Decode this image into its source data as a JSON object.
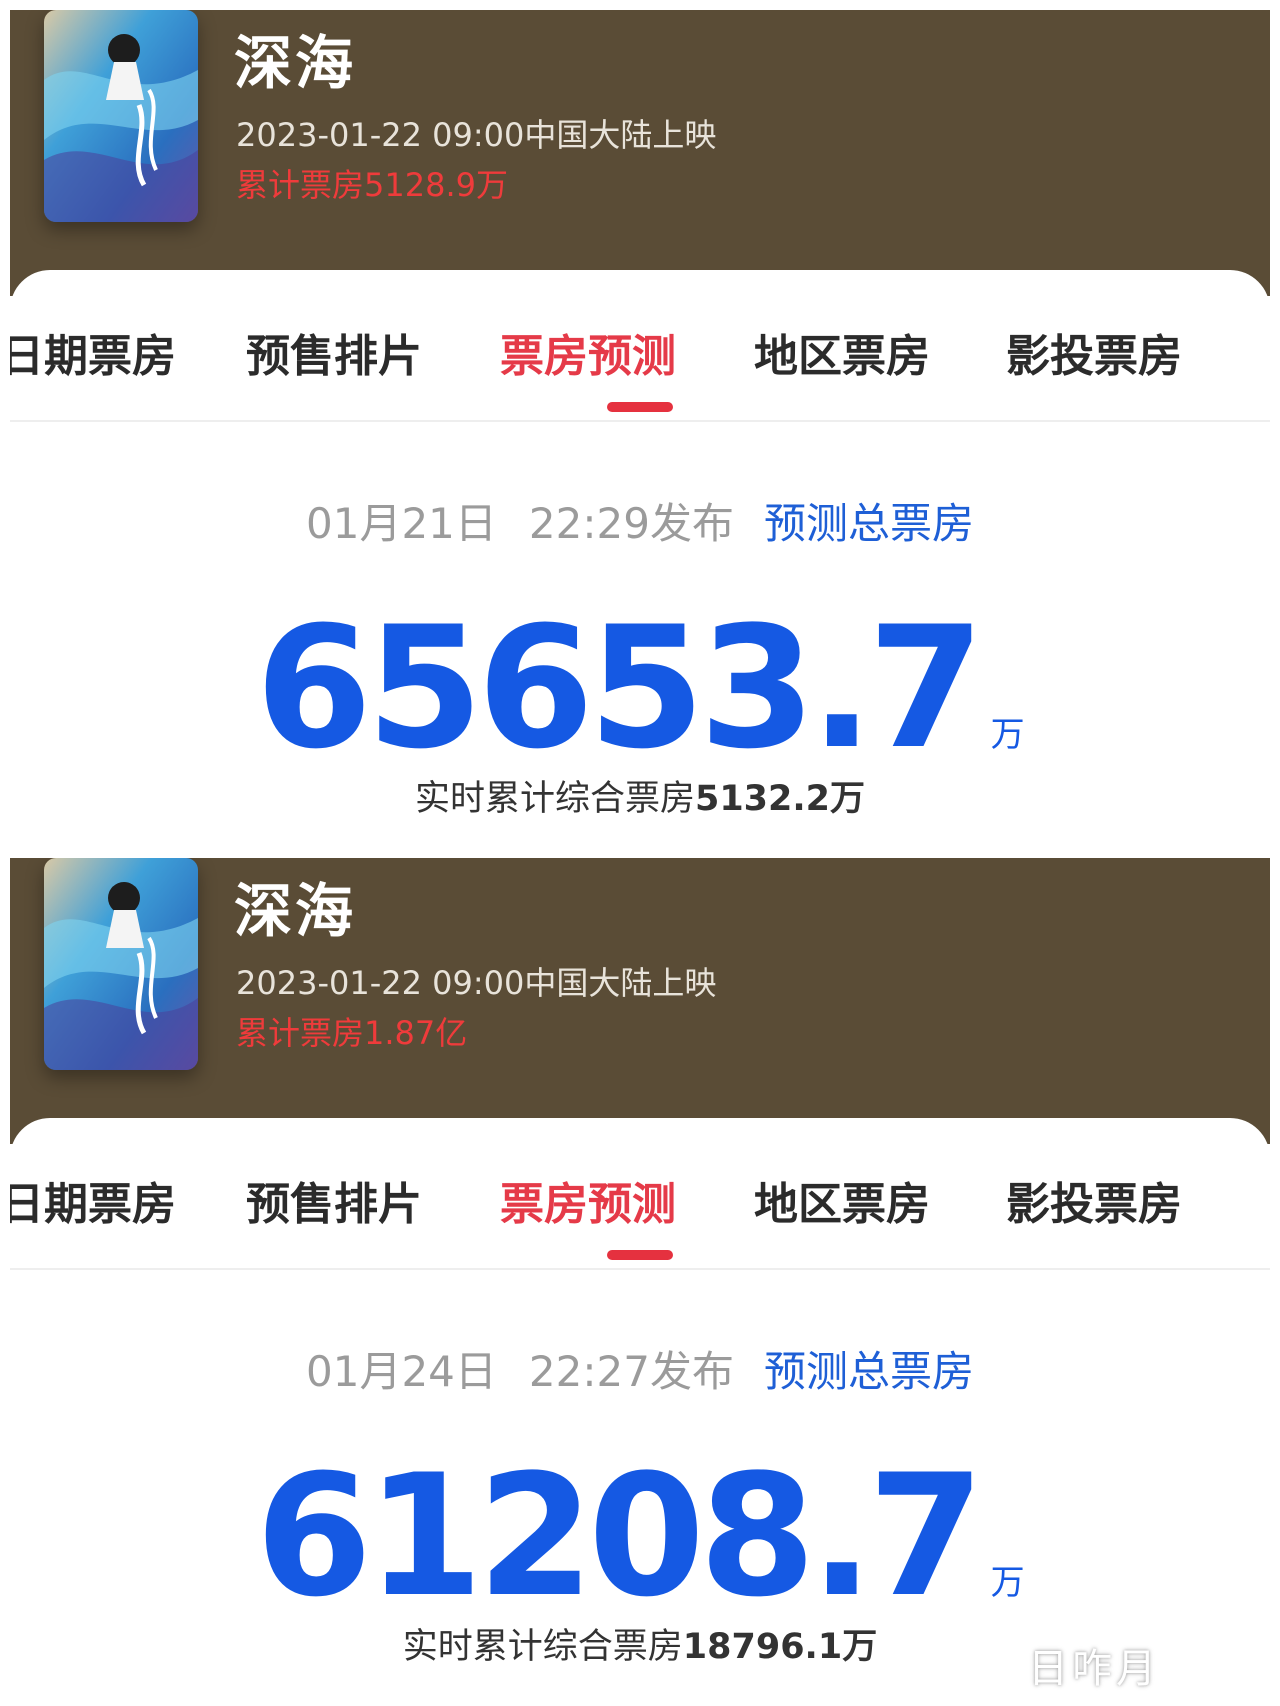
{
  "panels": [
    {
      "movie": {
        "title": "深海",
        "release_info": "2023-01-22 09:00中国大陆上映",
        "cumulative_box_office": "累计票房5128.9万"
      },
      "tabs": [
        "日期票房",
        "预售排片",
        "票房预测",
        "地区票房",
        "影投票房"
      ],
      "active_tab": "票房预测",
      "forecast": {
        "date": "01月21日",
        "time": "22:29发布",
        "label": "预测总票房",
        "value": "65653.7",
        "unit": "万",
        "realtime_label": "实时累计综合票房",
        "realtime_value": "5132.2万"
      }
    },
    {
      "movie": {
        "title": "深海",
        "release_info": "2023-01-22 09:00中国大陆上映",
        "cumulative_box_office": "累计票房1.87亿"
      },
      "tabs": [
        "日期票房",
        "预售排片",
        "票房预测",
        "地区票房",
        "影投票房"
      ],
      "active_tab": "票房预测",
      "forecast": {
        "date": "01月24日",
        "time": "22:27发布",
        "label": "预测总票房",
        "value": "61208.7",
        "unit": "万",
        "realtime_label": "实时累计综合票房",
        "realtime_value": "18796.1万"
      }
    }
  ],
  "watermark": "日咋月",
  "colors": {
    "header_bg": "#5a4c36",
    "active_tab": "#e53a48",
    "forecast_blue": "#1559e3",
    "cumulative_red": "#ef3b3b"
  }
}
